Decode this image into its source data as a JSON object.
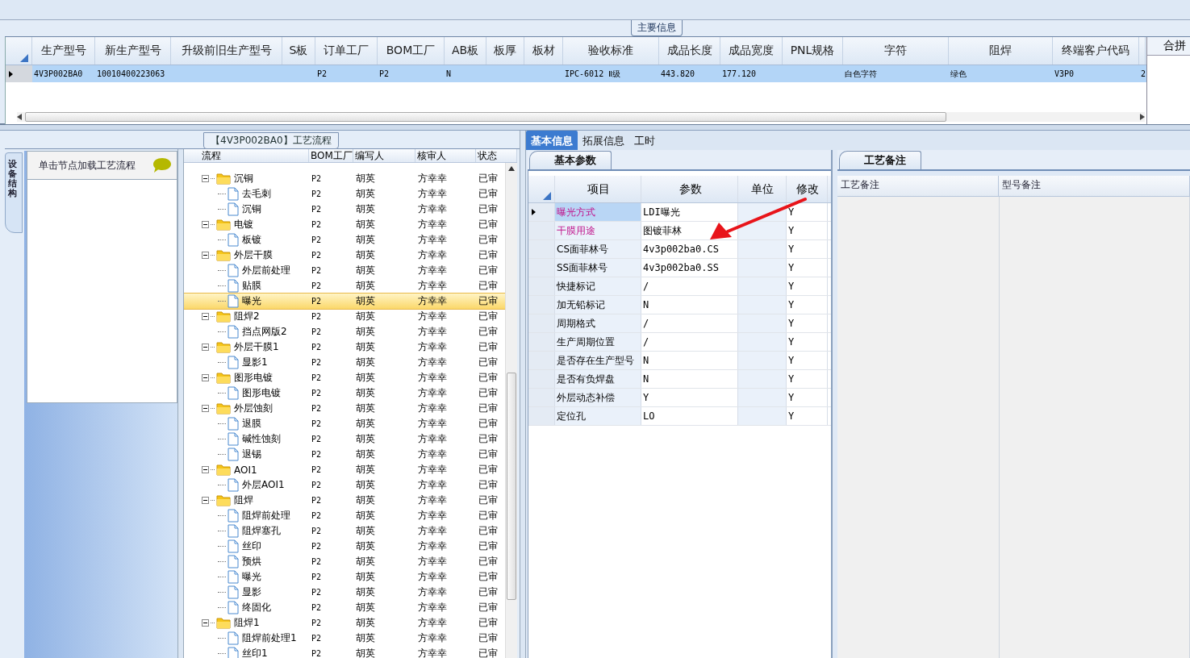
{
  "main_info": {
    "title": "主要信息",
    "columns": [
      {
        "header": "生产型号",
        "value": "4V3P002BA0"
      },
      {
        "header": "新生产型号",
        "value": "10010400223063"
      },
      {
        "header": "升级前旧生产型号"
      },
      {
        "header": "S板"
      },
      {
        "header": "订单工厂",
        "value": "P2"
      },
      {
        "header": "BOM工厂",
        "value": "P2"
      },
      {
        "header": "AB板",
        "value": "N"
      },
      {
        "header": "板厚"
      },
      {
        "header": "板材"
      },
      {
        "header": "验收标准",
        "value": "IPC-6012 Ⅱ级"
      },
      {
        "header": "成品长度",
        "value": "443.820"
      },
      {
        "header": "成品宽度",
        "value": "177.120"
      },
      {
        "header": "PNL规格"
      },
      {
        "header": "字符",
        "value": "白色字符"
      },
      {
        "header": "阻焊",
        "value": "绿色"
      },
      {
        "header": "终端客户代码",
        "value": "V3P0"
      },
      {
        "value": "2"
      }
    ],
    "row_selected": true,
    "side_header": "合拼"
  },
  "flow": {
    "title": "【4V3P002BA0】工艺流程",
    "side_tab": "设备结构",
    "hint": "单击节点加载工艺流程",
    "columns": [
      "流程",
      "BOM工厂",
      "编写人",
      "核审人",
      "状态"
    ],
    "nodes": [
      {
        "label": "沉铜",
        "kind": "folder",
        "expanded": true,
        "selected": false,
        "bom": "P2",
        "author": "胡英",
        "reviewer": "方幸幸",
        "status": "已审",
        "children": [
          {
            "label": "去毛刺",
            "kind": "doc",
            "selected": false,
            "bom": "P2",
            "author": "胡英",
            "reviewer": "方幸幸",
            "status": "已审"
          },
          {
            "label": "沉铜",
            "kind": "doc",
            "selected": false,
            "bom": "P2",
            "author": "胡英",
            "reviewer": "方幸幸",
            "status": "已审"
          }
        ]
      },
      {
        "label": "电镀",
        "kind": "folder",
        "expanded": true,
        "selected": false,
        "bom": "P2",
        "author": "胡英",
        "reviewer": "方幸幸",
        "status": "已审",
        "children": [
          {
            "label": "板镀",
            "kind": "doc",
            "selected": false,
            "bom": "P2",
            "author": "胡英",
            "reviewer": "方幸幸",
            "status": "已审"
          }
        ]
      },
      {
        "label": "外层干膜",
        "kind": "folder",
        "expanded": true,
        "selected": false,
        "bom": "P2",
        "author": "胡英",
        "reviewer": "方幸幸",
        "status": "已审",
        "children": [
          {
            "label": "外层前处理",
            "kind": "doc",
            "selected": false,
            "bom": "P2",
            "author": "胡英",
            "reviewer": "方幸幸",
            "status": "已审"
          },
          {
            "label": "贴膜",
            "kind": "doc",
            "selected": false,
            "bom": "P2",
            "author": "胡英",
            "reviewer": "方幸幸",
            "status": "已审"
          },
          {
            "label": "曝光",
            "kind": "doc",
            "selected": true,
            "bom": "P2",
            "author": "胡英",
            "reviewer": "方幸幸",
            "status": "已审"
          }
        ]
      },
      {
        "label": "阻焊2",
        "kind": "folder",
        "expanded": true,
        "selected": false,
        "bom": "P2",
        "author": "胡英",
        "reviewer": "方幸幸",
        "status": "已审",
        "children": [
          {
            "label": "挡点网版2",
            "kind": "doc",
            "selected": false,
            "bom": "P2",
            "author": "胡英",
            "reviewer": "方幸幸",
            "status": "已审"
          }
        ]
      },
      {
        "label": "外层干膜1",
        "kind": "folder",
        "expanded": true,
        "selected": false,
        "bom": "P2",
        "author": "胡英",
        "reviewer": "方幸幸",
        "status": "已审",
        "children": [
          {
            "label": "显影1",
            "kind": "doc",
            "selected": false,
            "bom": "P2",
            "author": "胡英",
            "reviewer": "方幸幸",
            "status": "已审"
          }
        ]
      },
      {
        "label": "图形电镀",
        "kind": "folder",
        "expanded": true,
        "selected": false,
        "bom": "P2",
        "author": "胡英",
        "reviewer": "方幸幸",
        "status": "已审",
        "children": [
          {
            "label": "图形电镀",
            "kind": "doc",
            "selected": false,
            "bom": "P2",
            "author": "胡英",
            "reviewer": "方幸幸",
            "status": "已审"
          }
        ]
      },
      {
        "label": "外层蚀刻",
        "kind": "folder",
        "expanded": true,
        "selected": false,
        "bom": "P2",
        "author": "胡英",
        "reviewer": "方幸幸",
        "status": "已审",
        "children": [
          {
            "label": "退膜",
            "kind": "doc",
            "selected": false,
            "bom": "P2",
            "author": "胡英",
            "reviewer": "方幸幸",
            "status": "已审"
          },
          {
            "label": "碱性蚀刻",
            "kind": "doc",
            "selected": false,
            "bom": "P2",
            "author": "胡英",
            "reviewer": "方幸幸",
            "status": "已审"
          },
          {
            "label": "退锡",
            "kind": "doc",
            "selected": false,
            "bom": "P2",
            "author": "胡英",
            "reviewer": "方幸幸",
            "status": "已审"
          }
        ]
      },
      {
        "label": "AOI1",
        "kind": "folder",
        "expanded": true,
        "selected": false,
        "bom": "P2",
        "author": "胡英",
        "reviewer": "方幸幸",
        "status": "已审",
        "children": [
          {
            "label": "外层AOI1",
            "kind": "doc",
            "selected": false,
            "bom": "P2",
            "author": "胡英",
            "reviewer": "方幸幸",
            "status": "已审"
          }
        ]
      },
      {
        "label": "阻焊",
        "kind": "folder",
        "expanded": true,
        "selected": false,
        "bom": "P2",
        "author": "胡英",
        "reviewer": "方幸幸",
        "status": "已审",
        "children": [
          {
            "label": "阻焊前处理",
            "kind": "doc",
            "selected": false,
            "bom": "P2",
            "author": "胡英",
            "reviewer": "方幸幸",
            "status": "已审"
          },
          {
            "label": "阻焊塞孔",
            "kind": "doc",
            "selected": false,
            "bom": "P2",
            "author": "胡英",
            "reviewer": "方幸幸",
            "status": "已审"
          },
          {
            "label": "丝印",
            "kind": "doc",
            "selected": false,
            "bom": "P2",
            "author": "胡英",
            "reviewer": "方幸幸",
            "status": "已审"
          },
          {
            "label": "预烘",
            "kind": "doc",
            "selected": false,
            "bom": "P2",
            "author": "胡英",
            "reviewer": "方幸幸",
            "status": "已审"
          },
          {
            "label": "曝光",
            "kind": "doc",
            "selected": false,
            "bom": "P2",
            "author": "胡英",
            "reviewer": "方幸幸",
            "status": "已审"
          },
          {
            "label": "显影",
            "kind": "doc",
            "selected": false,
            "bom": "P2",
            "author": "胡英",
            "reviewer": "方幸幸",
            "status": "已审"
          },
          {
            "label": "终固化",
            "kind": "doc",
            "selected": false,
            "bom": "P2",
            "author": "胡英",
            "reviewer": "方幸幸",
            "status": "已审"
          }
        ]
      },
      {
        "label": "阻焊1",
        "kind": "folder",
        "expanded": true,
        "selected": false,
        "bom": "P2",
        "author": "胡英",
        "reviewer": "方幸幸",
        "status": "已审",
        "children": [
          {
            "label": "阻焊前处理1",
            "kind": "doc",
            "selected": false,
            "bom": "P2",
            "author": "胡英",
            "reviewer": "方幸幸",
            "status": "已审"
          },
          {
            "label": "丝印1",
            "kind": "doc",
            "selected": false,
            "bom": "P2",
            "author": "胡英",
            "reviewer": "方幸幸",
            "status": "已审"
          }
        ]
      }
    ]
  },
  "tabs": [
    {
      "label": "基本信息",
      "selected": true
    },
    {
      "label": "拓展信息",
      "selected": false
    },
    {
      "label": "工时",
      "selected": false
    }
  ],
  "params": {
    "title": "基本参数",
    "columns": [
      "项目",
      "参数",
      "单位",
      "修改"
    ],
    "rows": [
      {
        "name": "曝光方式",
        "value": "LDI曝光",
        "modify": "Y",
        "required": true,
        "selected": true
      },
      {
        "name": "干膜用途",
        "value": "图镀菲林",
        "modify": "Y",
        "required": true,
        "selected": false
      },
      {
        "name": "CS面菲林号",
        "value": "4v3p002ba0.CS",
        "modify": "Y",
        "required": false,
        "selected": false
      },
      {
        "name": "SS面菲林号",
        "value": "4v3p002ba0.SS",
        "modify": "Y",
        "required": false,
        "selected": false
      },
      {
        "name": "快捷标记",
        "value": "/",
        "modify": "Y",
        "required": false,
        "selected": false
      },
      {
        "name": "加无铅标记",
        "value": "N",
        "modify": "Y",
        "required": false,
        "selected": false
      },
      {
        "name": "周期格式",
        "value": "/",
        "modify": "Y",
        "required": false,
        "selected": false
      },
      {
        "name": "生产周期位置",
        "value": "/",
        "modify": "Y",
        "required": false,
        "selected": false
      },
      {
        "name": "是否存在生产型号",
        "value": "N",
        "modify": "Y",
        "required": false,
        "selected": false
      },
      {
        "name": "是否有负焊盘",
        "value": "N",
        "modify": "Y",
        "required": false,
        "selected": false
      },
      {
        "name": "外层动态补偿",
        "value": "Y",
        "modify": "Y",
        "required": false,
        "selected": false
      },
      {
        "name": "定位孔",
        "value": "LO",
        "modify": "Y",
        "required": false,
        "selected": false
      }
    ]
  },
  "notes": {
    "title": "工艺备注",
    "columns": [
      "工艺备注",
      "型号备注"
    ]
  }
}
